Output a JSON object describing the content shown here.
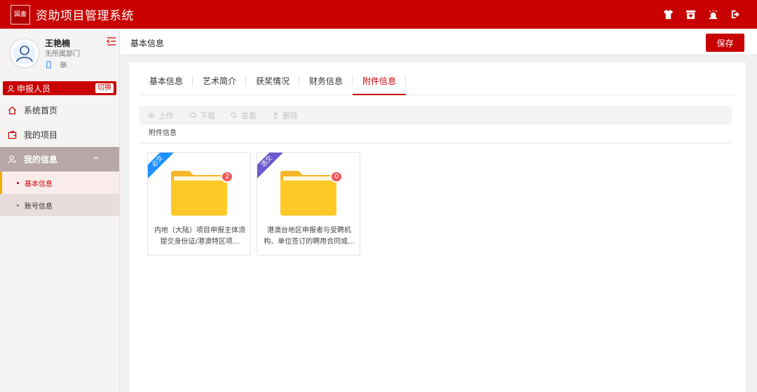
{
  "app": {
    "title": "资助项目管理系统",
    "logo_text": "図書"
  },
  "top_icons": [
    "shirt-icon",
    "archive-icon",
    "alarm-icon",
    "logout-icon"
  ],
  "user": {
    "name": "王艳楠",
    "dept": "无所属部门"
  },
  "role": {
    "label": "申报人员",
    "switch_label": "切换"
  },
  "menu": {
    "home": "系统首页",
    "projects": "我的项目",
    "my_info": "我的信息",
    "sub": {
      "basic": "基本信息",
      "account": "账号信息"
    }
  },
  "breadcrumb": "基本信息",
  "save_label": "保存",
  "tabs": [
    "基本信息",
    "艺术简介",
    "获奖情况",
    "财务信息",
    "附件信息"
  ],
  "active_tab": "附件信息",
  "toolbar": {
    "upload": "上传",
    "download": "下载",
    "view": "查看",
    "delete": "删除"
  },
  "section_title": "附件信息",
  "attachments": [
    {
      "tag": "必交",
      "tag_color": "#1e90ff",
      "count": "2",
      "caption": "内地（大陆）项目申报主体须提交身份证/港澳特区项..."
    },
    {
      "tag": "选交",
      "tag_color": "#6a5acd",
      "count": "0",
      "caption": "港澳台地区申报者与受聘机构、单位签订的聘用合同或..."
    }
  ],
  "colors": {
    "brand": "#c80000",
    "folder": "#ffc927",
    "badge": "#f2575b"
  }
}
